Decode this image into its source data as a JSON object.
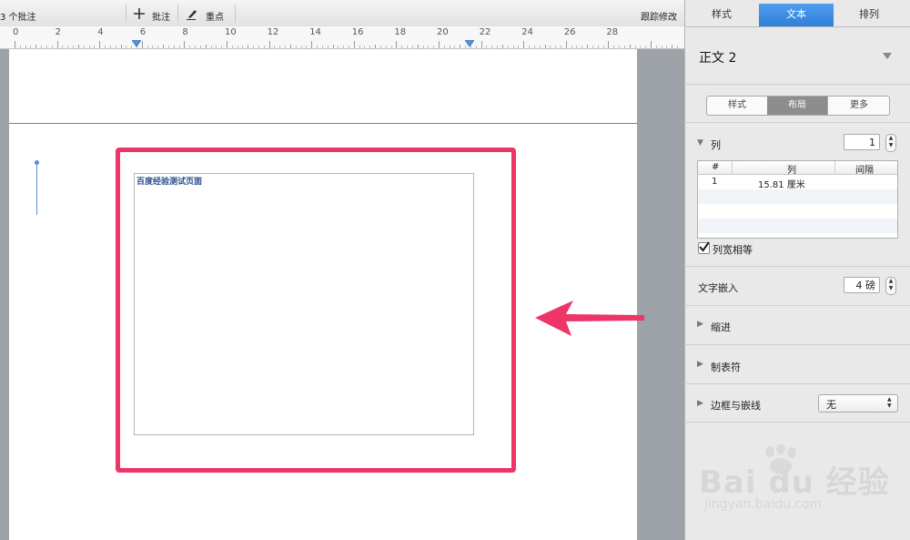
{
  "toolbar": {
    "comments_count": "3 个批注",
    "add_comment": "批注",
    "highlight": "重点",
    "track_changes": "跟踪修改"
  },
  "ruler": {
    "labels": [
      "0",
      "2",
      "4",
      "6",
      "8",
      "10",
      "12",
      "14",
      "16",
      "18",
      "20",
      "22",
      "24",
      "26",
      "28"
    ]
  },
  "document": {
    "textbox_text": "百度经验测试页面"
  },
  "sidebar": {
    "tabs": [
      "样式",
      "文本",
      "排列"
    ],
    "active_tab": "文本",
    "paragraph_style": "正文 2",
    "subtabs": [
      "样式",
      "布局",
      "更多"
    ],
    "active_subtab": "布局",
    "columns": {
      "label": "列",
      "count": "1",
      "table_headers": [
        "#",
        "列",
        "间隔"
      ],
      "rows": [
        {
          "num": "1",
          "width": "15.81 厘米",
          "gap": ""
        }
      ],
      "equal_width_label": "列宽相等",
      "equal_width_checked": true
    },
    "text_inset": {
      "label": "文字嵌入",
      "value": "4 磅"
    },
    "indent": "缩进",
    "tabs_section": "制表符",
    "borders": {
      "label": "边框与嵌线",
      "value": "无"
    }
  },
  "watermark": {
    "logo_text": "Bai du 经验",
    "url": "jingyan.baidu.com"
  },
  "colors": {
    "accent_blue": "#3d8ee6",
    "highlight_pink": "#ee3568",
    "subtab_active": "#8d8d8d"
  }
}
